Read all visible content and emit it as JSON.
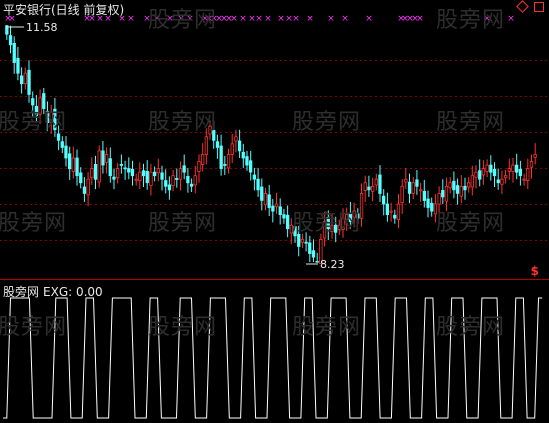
{
  "header": {
    "title": "平安银行(日线 前复权)",
    "max_price_label": "11.58",
    "min_price_label": "8.23"
  },
  "subchart": {
    "title": "股旁网",
    "indicator_label": "EXG: 0.00"
  },
  "watermark_text": "股旁网",
  "buttons": {
    "dollar": "$"
  },
  "colors": {
    "up": "#ff3030",
    "down": "#54ffff",
    "marker": "#ff33ff",
    "grid": "#8b0000",
    "divider": "#b00000",
    "line": "#ffffff"
  },
  "chart_data": [
    {
      "type": "candlestick",
      "title": "平安银行(日线 前复权)",
      "price_max": 11.58,
      "price_min": 8.23,
      "closes": [
        11.45,
        11.3,
        11.05,
        10.9,
        10.75,
        10.9,
        10.6,
        10.45,
        10.3,
        10.55,
        10.4,
        10.2,
        10.35,
        10.1,
        9.95,
        9.85,
        9.7,
        9.55,
        9.7,
        9.45,
        9.35,
        9.2,
        9.4,
        9.55,
        9.4,
        9.8,
        9.6,
        9.75,
        9.45,
        9.4,
        9.55,
        9.6,
        9.55,
        9.5,
        9.45,
        9.4,
        9.5,
        9.45,
        9.35,
        9.5,
        9.45,
        9.55,
        9.4,
        9.3,
        9.25,
        9.45,
        9.4,
        9.55,
        9.5,
        9.35,
        9.3,
        9.45,
        9.65,
        9.75,
        10.0,
        10.15,
        9.95,
        9.85,
        9.55,
        9.6,
        9.75,
        9.9,
        10.0,
        9.8,
        9.7,
        9.6,
        9.5,
        9.4,
        9.25,
        9.1,
        9.2,
        9.0,
        8.95,
        9.05,
        8.9,
        8.85,
        8.7,
        8.75,
        8.6,
        8.45,
        8.55,
        8.5,
        8.35,
        8.3,
        8.23,
        8.55,
        8.8,
        8.7,
        8.75,
        8.65,
        8.75,
        8.85,
        8.9,
        8.8,
        8.95,
        8.85,
        9.2,
        9.35,
        9.25,
        9.3,
        9.4,
        9.2,
        9.05,
        8.9,
        8.95,
        8.85,
        9.05,
        9.3,
        9.4,
        9.2,
        9.35,
        9.3,
        9.25,
        9.1,
        9.0,
        8.95,
        9.05,
        9.2,
        9.15,
        9.3,
        9.35,
        9.25,
        9.2,
        9.3,
        9.25,
        9.35,
        9.45,
        9.5,
        9.4,
        9.55,
        9.6,
        9.5,
        9.45,
        9.35,
        9.4,
        9.45,
        9.55,
        9.6,
        9.5,
        9.45,
        9.4,
        9.55,
        9.65,
        9.75
      ]
    },
    {
      "type": "line",
      "title": "股旁网",
      "series": [
        {
          "name": "EXG",
          "values": [
            0,
            0,
            1,
            1,
            1,
            1,
            1,
            1,
            0,
            0,
            0,
            0,
            0,
            0,
            1,
            1,
            1,
            1,
            0,
            0,
            0,
            0,
            1,
            1,
            1,
            0,
            0,
            0,
            0,
            1,
            1,
            1,
            1,
            1,
            1,
            0,
            0,
            0,
            0,
            1,
            1,
            1,
            0,
            0,
            0,
            0,
            0,
            1,
            1,
            1,
            1,
            0,
            0,
            0,
            0,
            1,
            1,
            1,
            1,
            1,
            0,
            0,
            0,
            0,
            1,
            1,
            1,
            0,
            0,
            0,
            0,
            1,
            1,
            1,
            1,
            1,
            0,
            0,
            0,
            0,
            1,
            1,
            1,
            0,
            0,
            0,
            0,
            1,
            1,
            1,
            1,
            1,
            0,
            0,
            0,
            0,
            1,
            1,
            1,
            1,
            0,
            0,
            0,
            0,
            1,
            1,
            1,
            1,
            0,
            0,
            0,
            0,
            1,
            1,
            1,
            0,
            0,
            0,
            0,
            1,
            1,
            1,
            1,
            0,
            0,
            0,
            0,
            1,
            1,
            1,
            1,
            1,
            0,
            0,
            0,
            0,
            1,
            1,
            1,
            0,
            0,
            0,
            1,
            1
          ]
        }
      ]
    }
  ]
}
